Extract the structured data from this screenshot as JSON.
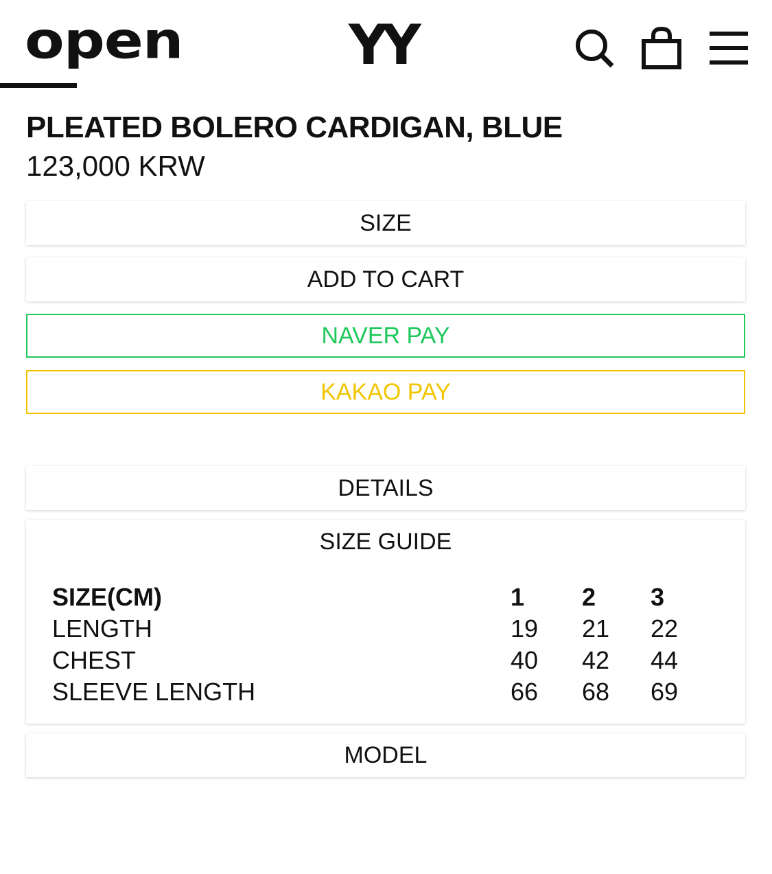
{
  "header": {
    "logo_left": "open",
    "logo_center": "YY",
    "icons": [
      "search-icon",
      "shopping-bag-icon",
      "menu-icon"
    ]
  },
  "product": {
    "title": "PLEATED BOLERO CARDIGAN, BLUE",
    "price": "123,000 KRW"
  },
  "actions": {
    "size_label": "SIZE",
    "add_to_cart_label": "ADD TO CART",
    "naver_pay_label": "NAVER PAY",
    "kakao_pay_label": "KAKAO PAY"
  },
  "sections": {
    "details_label": "DETAILS",
    "size_guide_label": "SIZE GUIDE",
    "model_label": "MODEL"
  },
  "size_guide": {
    "header": [
      "SIZE(CM)",
      "1",
      "2",
      "3"
    ],
    "rows": [
      [
        "LENGTH",
        "19",
        "21",
        "22"
      ],
      [
        "CHEST",
        "40",
        "42",
        "44"
      ],
      [
        "SLEEVE LENGTH",
        "66",
        "68",
        "69"
      ]
    ]
  },
  "colors": {
    "text": "#111111",
    "naver_green": "#1ec85a",
    "kakao_yellow": "#f2c500",
    "background": "#ffffff"
  }
}
